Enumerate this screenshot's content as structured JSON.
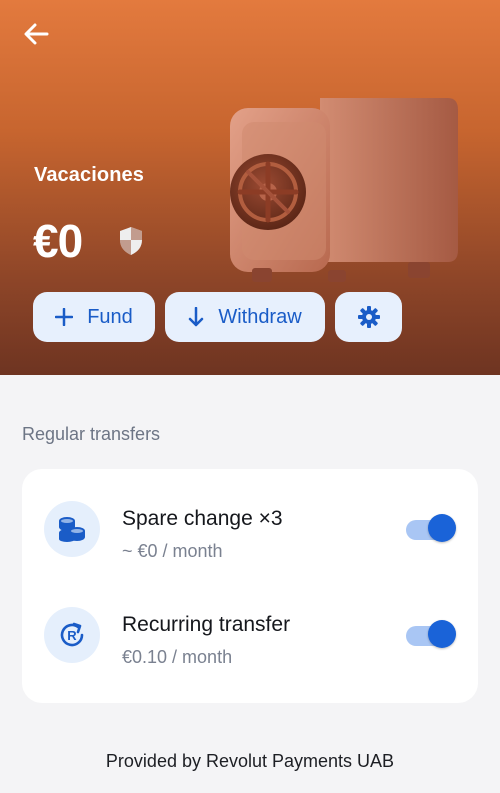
{
  "pocket": {
    "name": "Vacaciones",
    "balance": "€0"
  },
  "actions": {
    "fund_label": "Fund",
    "withdraw_label": "Withdraw"
  },
  "regular_transfers": {
    "section_title": "Regular transfers",
    "items": [
      {
        "title": "Spare change ×3",
        "subtitle": "~ €0 / month",
        "enabled": true,
        "icon": "coins-icon"
      },
      {
        "title": "Recurring transfer",
        "subtitle": "€0.10 / month",
        "enabled": true,
        "icon": "recurring-icon"
      }
    ]
  },
  "footer": {
    "provider_text": "Provided by Revolut Payments UAB"
  },
  "colors": {
    "accent": "#1a63d8",
    "accent_light": "#e7f0fd",
    "hero_top": "#e37a3e",
    "hero_bottom": "#6e3421"
  }
}
